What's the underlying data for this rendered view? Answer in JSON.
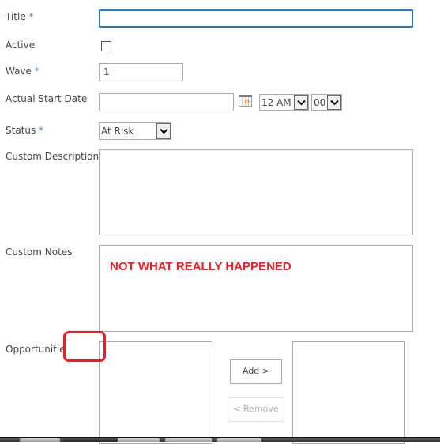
{
  "form": {
    "title": {
      "label": "Title",
      "required_marker": "*",
      "value": ""
    },
    "active": {
      "label": "Active",
      "checked": false
    },
    "wave": {
      "label": "Wave",
      "required_marker": "*",
      "value": "1"
    },
    "actual_start_date": {
      "label": "Actual Start Date",
      "date_value": "",
      "calendar_icon": "calendar-icon",
      "hour": "12 AM",
      "minute": "00"
    },
    "status": {
      "label": "Status",
      "required_marker": "*",
      "value": "At Risk"
    },
    "custom_description": {
      "label": "Custom Description",
      "value": ""
    },
    "custom_notes": {
      "label": "Custom Notes",
      "value": "NOT WHAT REALLY HAPPENED"
    },
    "opportunities": {
      "label": "Opportunitie",
      "available_items": [],
      "selected_items": [],
      "add_label": "Add >",
      "remove_label": "< Remove"
    }
  },
  "annotation": {
    "shape": "rounded-rectangle",
    "color": "#e8202a"
  },
  "colors": {
    "required_marker": "#4a8ac2",
    "focus_border": "#2a7ac0",
    "notes_text": "#e8202a"
  }
}
